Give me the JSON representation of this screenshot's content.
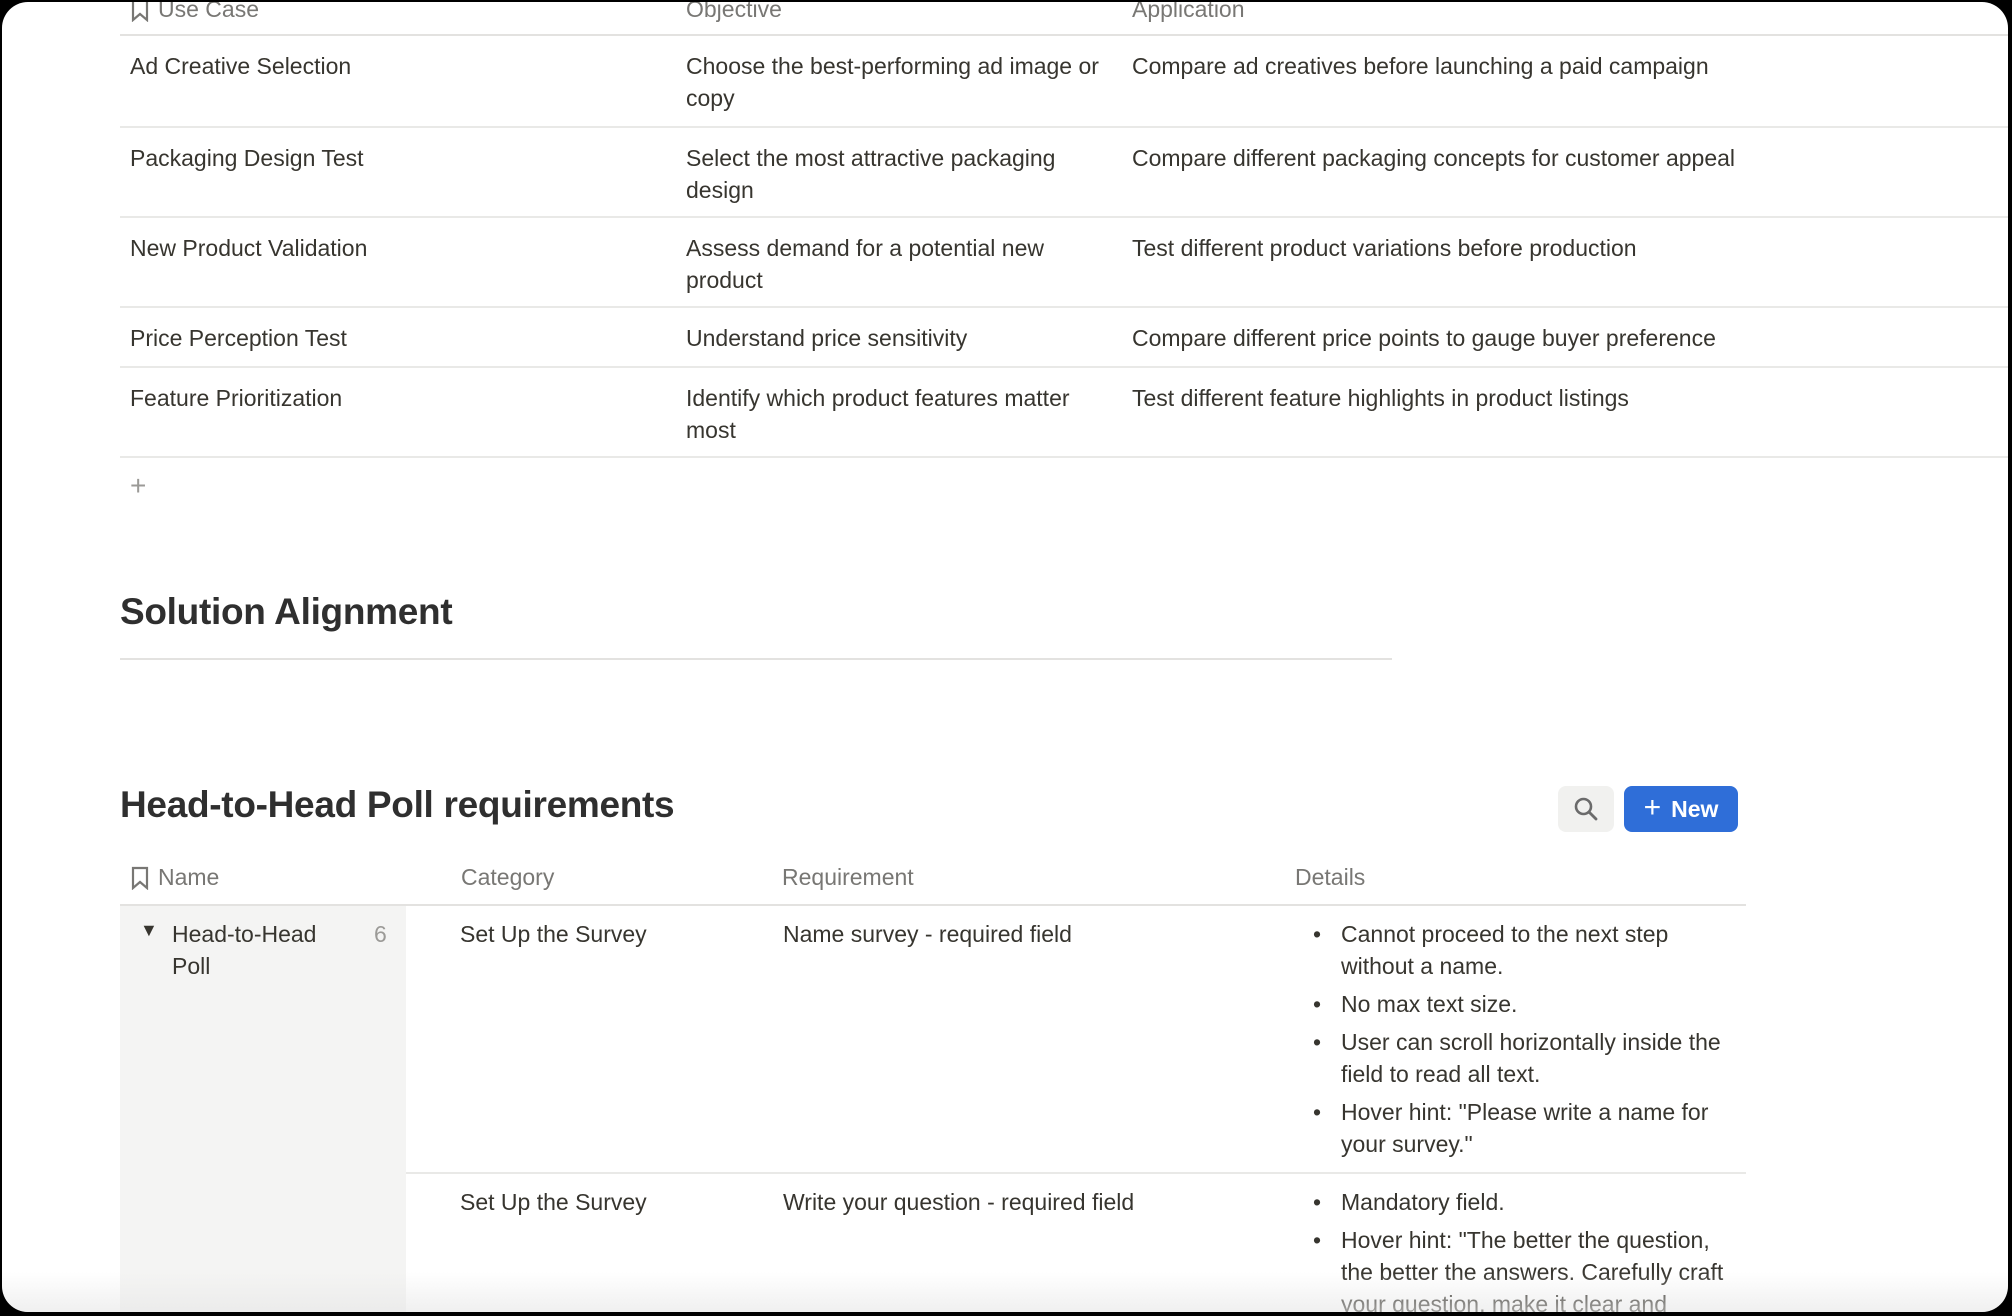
{
  "use_case_table": {
    "columns": [
      "Use Case",
      "Objective",
      "Application"
    ],
    "rows": [
      {
        "use_case": "Ad Creative Selection",
        "objective": "Choose the best-performing ad image or copy",
        "application": "Compare ad creatives before launching a paid campaign"
      },
      {
        "use_case": "Packaging Design Test",
        "objective": "Select the most attractive packaging design",
        "application": "Compare different packaging concepts for customer appeal"
      },
      {
        "use_case": "New Product Validation",
        "objective": "Assess demand for a potential new product",
        "application": "Test different product variations before production"
      },
      {
        "use_case": "Price Perception Test",
        "objective": "Understand price sensitivity",
        "application": "Compare different price points to gauge buyer preference"
      },
      {
        "use_case": "Feature Prioritization",
        "objective": "Identify which product features matter most",
        "application": "Test different feature highlights in product listings"
      }
    ],
    "add_row_icon": "+"
  },
  "section_heading": "Solution Alignment",
  "requirements_db": {
    "title": "Head-to-Head Poll requirements",
    "search_icon": "search-icon",
    "new_button_label": "New",
    "new_button_icon": "+",
    "accent_color": "#2f6ed8",
    "columns": [
      "Name",
      "Category",
      "Requirement",
      "Details"
    ],
    "group": {
      "toggle": "▼",
      "name": "Head-to-Head Poll",
      "count": "6"
    },
    "rows": [
      {
        "category": "Set Up the Survey",
        "requirement": "Name survey - required field",
        "details": [
          "Cannot proceed to the next step without a name.",
          " No max text size.",
          " User can scroll horizontally inside the field to read all text.",
          "Hover hint: \"Please write a name for your survey.\""
        ]
      },
      {
        "category": "Set Up the Survey",
        "requirement": "Write your question - required field",
        "details": [
          "Mandatory field.",
          " Hover hint: \"The better the question, the better the answers. Carefully craft your question, make it clear and"
        ]
      }
    ]
  }
}
